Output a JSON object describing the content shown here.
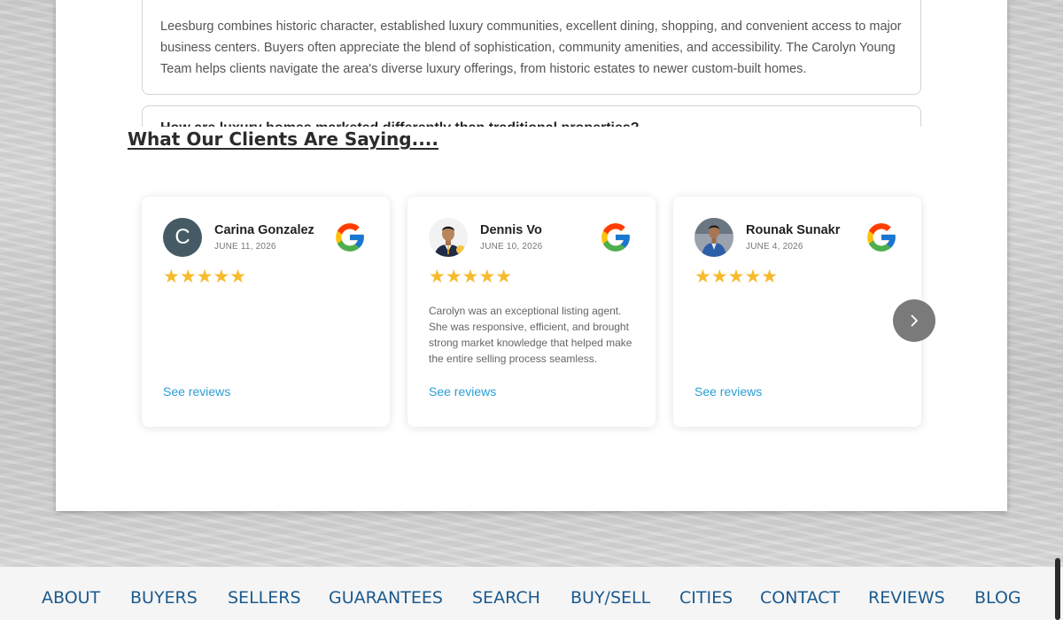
{
  "faq": {
    "answer": "Leesburg combines historic character, established luxury communities, excellent dining, shopping, and convenient access to major business centers. Buyers often appreciate the blend of sophistication, community amenities, and accessibility. The Carolyn Young Team helps clients navigate the area's diverse luxury offerings, from historic estates to newer custom-built homes.",
    "next_question": "How are luxury homes marketed differently than traditional properties?"
  },
  "testimonials": {
    "title": "What Our Clients Are Saying....",
    "star_color": "#f6bb2d",
    "link_color": "#2a9fd6",
    "reviews": [
      {
        "name": "Carina Gonzalez",
        "date": "JUNE 11, 2026",
        "avatar": "C",
        "stars": "★★★★★",
        "rating": 5,
        "text": "",
        "link": "See reviews"
      },
      {
        "name": "Dennis Vo",
        "date": "JUNE 10, 2026",
        "avatar": "photo",
        "stars": "★★★★★",
        "rating": 5,
        "text": "Carolyn was an exceptional listing agent. She was responsive, efficient, and brought strong market knowledge that helped make the entire selling process seamless.",
        "link": "See reviews"
      },
      {
        "name": "Rounak Sunakr",
        "date": "JUNE 4, 2026",
        "avatar": "photo",
        "stars": "★★★★★",
        "rating": 5,
        "text": "",
        "link": "See reviews"
      }
    ],
    "next_icon": "chevron-right-icon"
  },
  "footer_nav": {
    "color": "#1c5a8e",
    "items": [
      "ABOUT",
      "BUYERS",
      "SELLERS",
      "GUARANTEES",
      "SEARCH",
      "BUY/SELL",
      "CITIES",
      "CONTACT",
      "REVIEWS",
      "BLOG"
    ]
  }
}
